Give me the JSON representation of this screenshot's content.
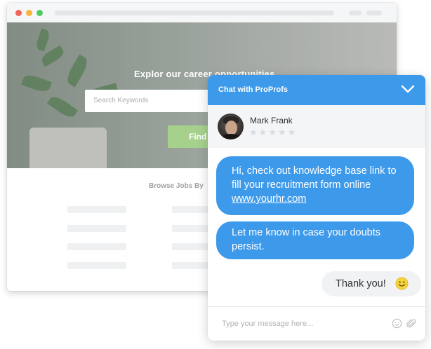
{
  "careers": {
    "title": "Explor our career opportunities",
    "search_placeholder": "Search Keywords",
    "find_label": "Find",
    "browse_label": "Browse Jobs By"
  },
  "chat": {
    "header_title": "Chat with ProProfs",
    "agent_name": "Mark Frank",
    "rating_stars": "★★★★★",
    "messages": [
      {
        "from": "agent",
        "text": "Hi, check out knowledge base link to fill your recruitment form online",
        "link": "www.yourhr.com"
      },
      {
        "from": "agent",
        "text": "Let me know in case your doubts persist."
      },
      {
        "from": "user",
        "text": "Thank you!"
      }
    ],
    "composer_placeholder": "Type your message here..."
  },
  "colors": {
    "chat_blue": "#3d99e9",
    "find_green": "#a6d18c",
    "user_bubble": "#f1f2f4"
  },
  "icons": [
    "chevron-down-icon",
    "smiley-icon",
    "emoji-icon",
    "paperclip-icon"
  ]
}
